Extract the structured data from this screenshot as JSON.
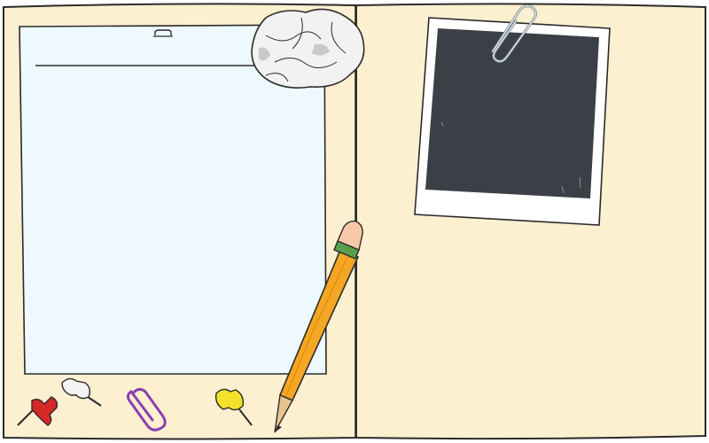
{
  "scene": {
    "kind": "open folder desk illustration",
    "items": [
      {
        "name": "left-folder-panel",
        "icon": "folder-panel"
      },
      {
        "name": "right-folder-panel",
        "icon": "folder-panel"
      },
      {
        "name": "notepad",
        "icon": "lined-paper"
      },
      {
        "name": "crumpled-paper",
        "icon": "crumpled-paper-ball"
      },
      {
        "name": "polaroid-photo",
        "icon": "instant-photo-frame"
      },
      {
        "name": "paperclip-on-photo",
        "icon": "paperclip"
      },
      {
        "name": "pencil",
        "icon": "yellow-pencil"
      },
      {
        "name": "red-pushpin",
        "icon": "pushpin"
      },
      {
        "name": "white-pushpin",
        "icon": "pushpin"
      },
      {
        "name": "purple-paperclip",
        "icon": "paperclip"
      },
      {
        "name": "yellow-pushpin",
        "icon": "pushpin"
      }
    ]
  },
  "colors": {
    "folder": "#fdf0d0",
    "folder_outline": "#2b2b2b",
    "paper": "#eef9ff",
    "photo_frame": "#ffffff",
    "photo_image": "#3a4046",
    "pencil_body": "#f5a623",
    "pencil_eraser": "#f7c9a8",
    "pencil_band": "#5aa04a",
    "pin_red": "#d62828",
    "pin_white": "#f4f4f4",
    "pin_yellow": "#f2e22a",
    "clip_purple": "#8a3fb0",
    "crumple": "#f2f2f2"
  }
}
